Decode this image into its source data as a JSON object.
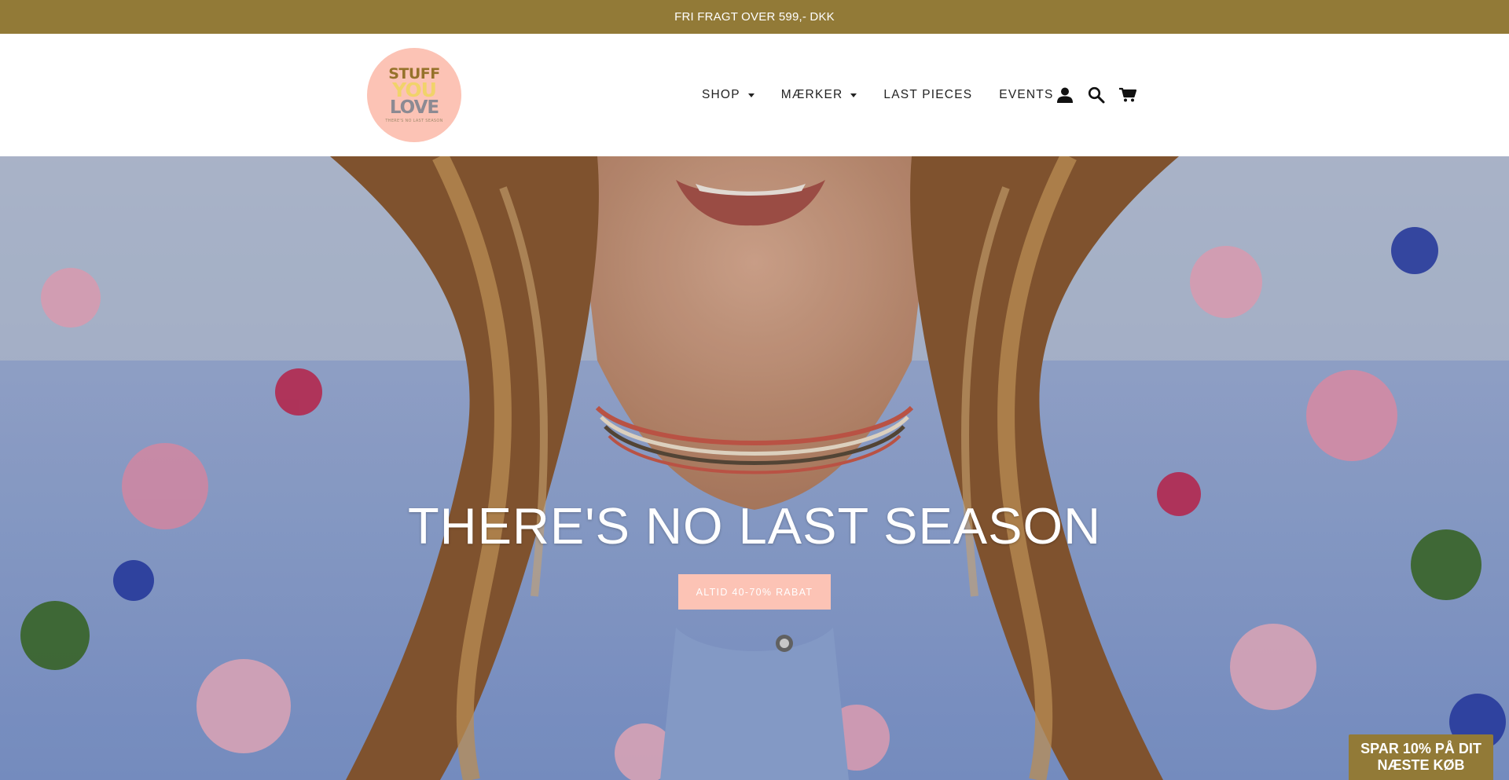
{
  "announcement": {
    "text": "FRI FRAGT OVER 599,- DKK"
  },
  "logo": {
    "line1": "STUFF",
    "line2": "YOU",
    "line3": "LOVE",
    "tagline": "THERE'S NO LAST SEASON"
  },
  "nav": {
    "items": [
      {
        "label": "SHOP",
        "has_dropdown": true
      },
      {
        "label": "MÆRKER",
        "has_dropdown": true
      },
      {
        "label": "LAST PIECES",
        "has_dropdown": false
      },
      {
        "label": "EVENTS",
        "has_dropdown": false
      }
    ],
    "icons": [
      "account-icon",
      "search-icon",
      "cart-icon"
    ]
  },
  "hero": {
    "title": "THERE'S NO LAST SEASON",
    "button_label": "ALTID 40-70% RABAT"
  },
  "promo": {
    "line1": "SPAR 10% PÅ DIT",
    "line2": "NÆSTE KØB"
  },
  "colors": {
    "brand_gold": "#927a37",
    "brand_peach": "#fcc3b5",
    "text_dark": "#222222",
    "hero_blue": "#8aa2d2"
  }
}
